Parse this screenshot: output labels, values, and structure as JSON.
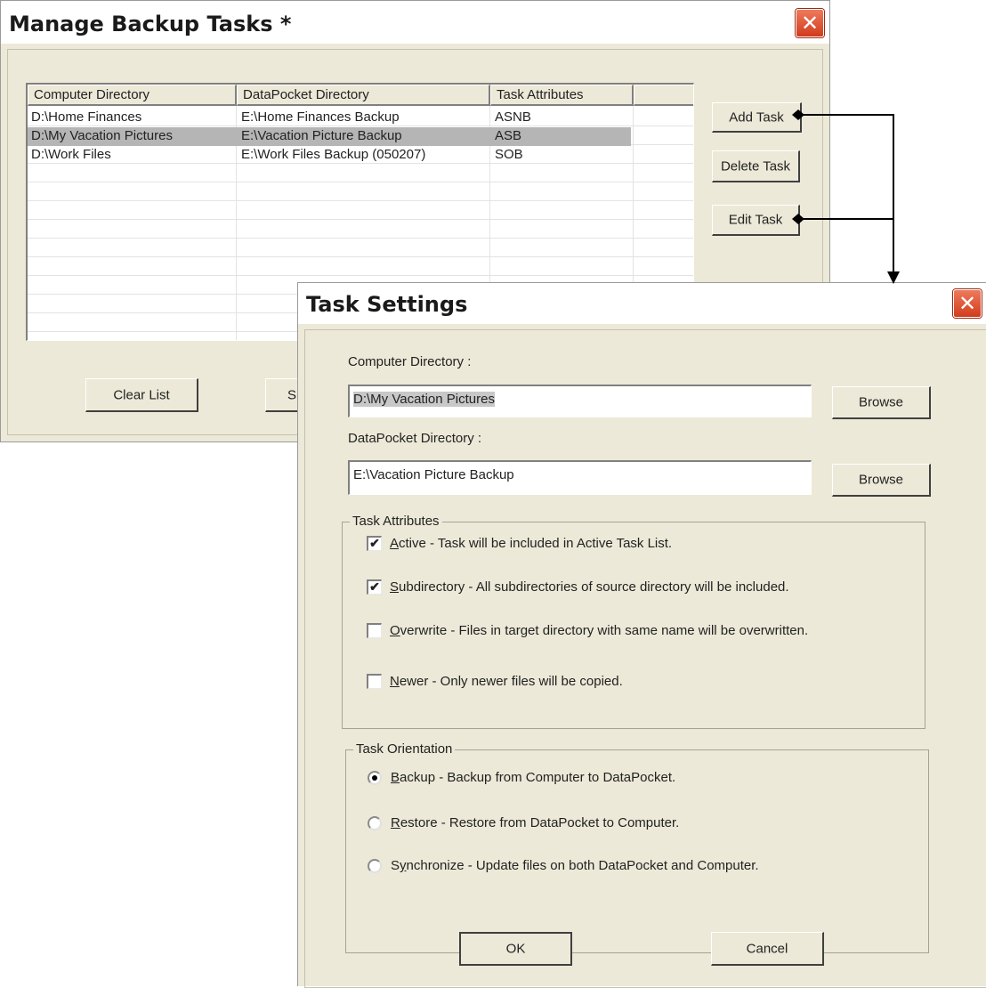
{
  "manage_window": {
    "title": "Manage Backup Tasks *",
    "close_glyph": "✕",
    "list": {
      "columns": [
        "Computer Directory",
        "DataPocket Directory",
        "Task Attributes",
        ""
      ],
      "rows": [
        {
          "computer": "D:\\Home Finances",
          "datapocket": "E:\\Home Finances Backup",
          "attributes": "ASNB",
          "selected": false
        },
        {
          "computer": "D:\\My Vacation Pictures",
          "datapocket": "E:\\Vacation Picture Backup",
          "attributes": "ASB",
          "selected": true
        },
        {
          "computer": "D:\\Work Files",
          "datapocket": "E:\\Work Files Backup (050207)",
          "attributes": "SOB",
          "selected": false
        }
      ]
    },
    "buttons": {
      "add_task": "Add Task",
      "delete_task": "Delete Task",
      "edit_task": "Edit Task",
      "clear_list": "Clear List",
      "partial_button": "S"
    }
  },
  "task_settings": {
    "title": "Task Settings",
    "close_glyph": "✕",
    "computer_directory_label": "Computer Directory :",
    "computer_directory_value": "D:\\My Vacation Pictures",
    "datapocket_directory_label": "DataPocket Directory :",
    "datapocket_directory_value": "E:\\Vacation Picture Backup",
    "browse_label": "Browse",
    "attributes": {
      "legend": "Task Attributes",
      "options": [
        {
          "key": "A",
          "rest": "ctive - Task will be included in Active Task List.",
          "checked": true
        },
        {
          "key": "S",
          "rest": "ubdirectory - All subdirectories of source directory will be included.",
          "checked": true
        },
        {
          "key": "O",
          "rest": "verwrite - Files in target directory with same name will be overwritten.",
          "checked": false
        },
        {
          "key": "N",
          "rest": "ewer - Only newer files will be copied.",
          "checked": false
        }
      ]
    },
    "orientation": {
      "legend": "Task Orientation",
      "options": [
        {
          "pre": "",
          "key": "B",
          "rest": "ackup - Backup from Computer to DataPocket.",
          "selected": true
        },
        {
          "pre": "",
          "key": "R",
          "rest": "estore - Restore from DataPocket to Computer.",
          "selected": false
        },
        {
          "pre": "S",
          "key": "y",
          "rest": "nchronize - Update files on both DataPocket and Computer.",
          "selected": false
        }
      ]
    },
    "ok_label": "OK",
    "cancel_label": "Cancel"
  },
  "icons": {
    "check_glyph": "✔",
    "connector_marker": "diamond",
    "arrow": "arrow-down"
  },
  "colors": {
    "close_button": "#d13c1c",
    "window_face": "#ece9d8",
    "selected_row": "#b5b5b5"
  }
}
